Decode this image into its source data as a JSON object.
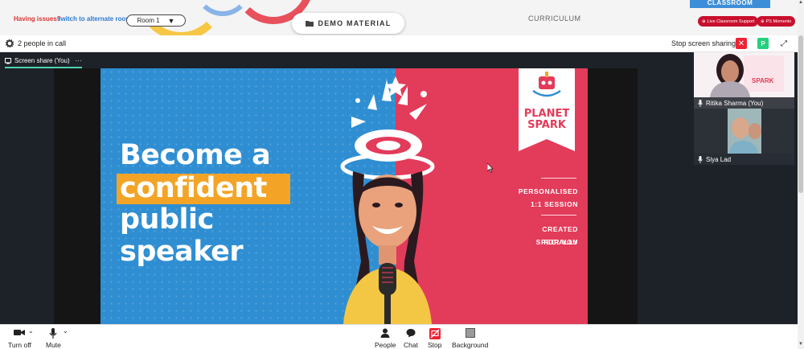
{
  "topbar": {
    "issues_label": "Having issues?",
    "alt_room_link": "switch to alternate room",
    "room_select": "Room 1",
    "demo_material": "DEMO MATERIAL",
    "curriculum": "CURRICULUM",
    "classroom_tag": "CLASSROOM",
    "live_support": "Live Classroom Support",
    "ps_moments": "PS Moments"
  },
  "callbar": {
    "people_count": "2 people in call",
    "stop_sharing": "Stop screen sharing",
    "participant_badge": "P"
  },
  "stage": {
    "tab_label": "Screen share (You)",
    "tab_more": "···"
  },
  "slide": {
    "line1": "Become a",
    "line2": "confident",
    "line3": "public",
    "line4": "speaker",
    "brand_top": "PLANET",
    "brand_bottom": "SPARK",
    "personalised": "PERSONALISED",
    "session": "1:1 SESSION",
    "created": "CREATED SPECIALLY",
    "for_you": "FOR YOU",
    "colors": {
      "blue": "#2f8ed2",
      "red": "#e33b5a",
      "highlight": "#f3a427"
    }
  },
  "participants": [
    {
      "name": "Ritika Sharma (You)"
    },
    {
      "name": "Siya Lad"
    }
  ],
  "bottombar": {
    "video": "Turn off",
    "mute": "Mute",
    "people": "People",
    "chat": "Chat",
    "stop": "Stop",
    "background": "Background"
  },
  "icons": [
    "gear-icon",
    "folder-icon",
    "close-icon",
    "expand-icon",
    "mic-icon",
    "video-camera-icon",
    "people-icon",
    "chat-icon",
    "stop-share-icon",
    "background-icon",
    "chevron-down-icon"
  ]
}
